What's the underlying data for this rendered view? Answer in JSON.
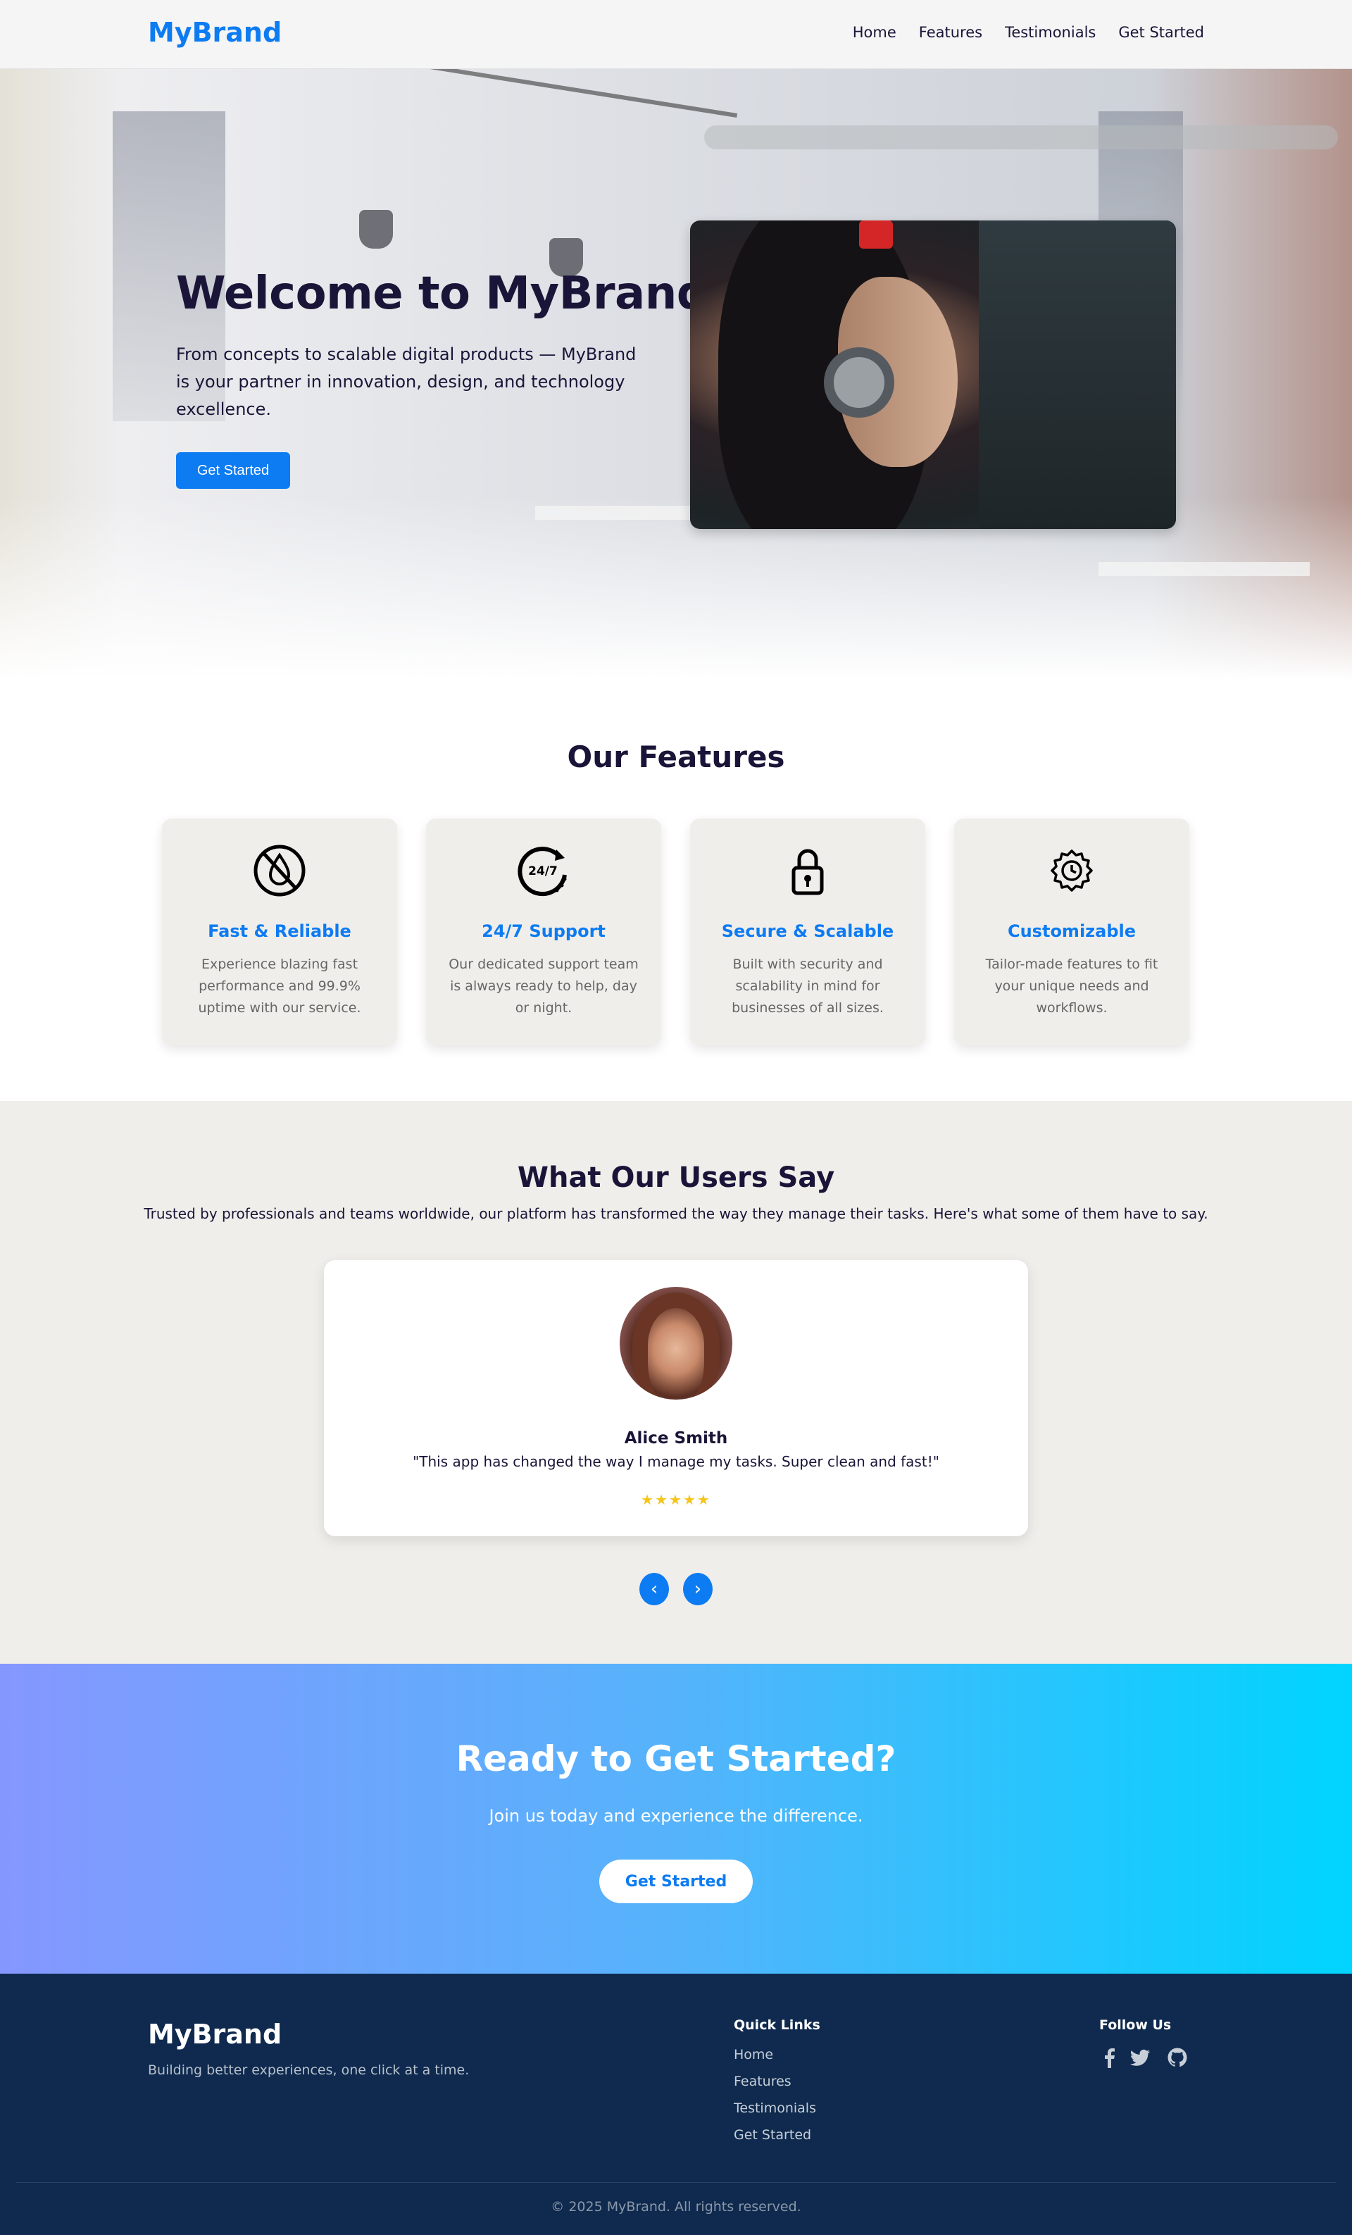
{
  "nav": {
    "brand": "MyBrand",
    "links": [
      "Home",
      "Features",
      "Testimonials",
      "Get Started"
    ]
  },
  "hero": {
    "title": "Welcome to MyBrand",
    "subtitle": "From concepts to scalable digital products — MyBrand is your partner in innovation, design, and technology excellence.",
    "button": "Get Started"
  },
  "features": {
    "title": "Our Features",
    "items": [
      {
        "title": "Fast & Reliable",
        "desc": "Experience blazing fast performance and 99.9% uptime with our service.",
        "icon": "drop-slash-icon"
      },
      {
        "title": "24/7 Support",
        "desc": "Our dedicated support team is always ready to help, day or night.",
        "icon": "clock-24-7-icon",
        "icon_text": "24/7"
      },
      {
        "title": "Secure & Scalable",
        "desc": "Built with security and scalability in mind for businesses of all sizes.",
        "icon": "lock-icon"
      },
      {
        "title": "Customizable",
        "desc": "Tailor-made features to fit your unique needs and workflows.",
        "icon": "gear-clock-icon"
      }
    ]
  },
  "testimonials": {
    "title": "What Our Users Say",
    "subtitle": "Trusted by professionals and teams worldwide, our platform has transformed the way they manage their tasks. Here's what some of them have to say.",
    "name": "Alice Smith",
    "quote": "\"This app has changed the way I manage my tasks. Super clean and fast!\"",
    "stars": "★★★★★",
    "rating": 5,
    "prev": "‹",
    "next": "›"
  },
  "cta": {
    "title": "Ready to Get Started?",
    "subtitle": "Join us today and experience the difference.",
    "button": "Get Started"
  },
  "footer": {
    "brand": "MyBrand",
    "tagline": "Building better experiences, one click at a time.",
    "quick_links_title": "Quick Links",
    "quick_links": [
      "Home",
      "Features",
      "Testimonials",
      "Get Started"
    ],
    "follow_title": "Follow Us",
    "social": [
      "facebook-icon",
      "twitter-icon",
      "github-icon"
    ],
    "copyright": "© 2025 MyBrand. All rights reserved."
  },
  "colors": {
    "accent": "#0d7bf2",
    "text": "#1a1538",
    "card_bg": "#efeeea",
    "footer_bg": "#0f2a4e",
    "cta_gradient_start": "#8597ff",
    "cta_gradient_end": "#00d4ff",
    "stars": "#f5c518"
  }
}
